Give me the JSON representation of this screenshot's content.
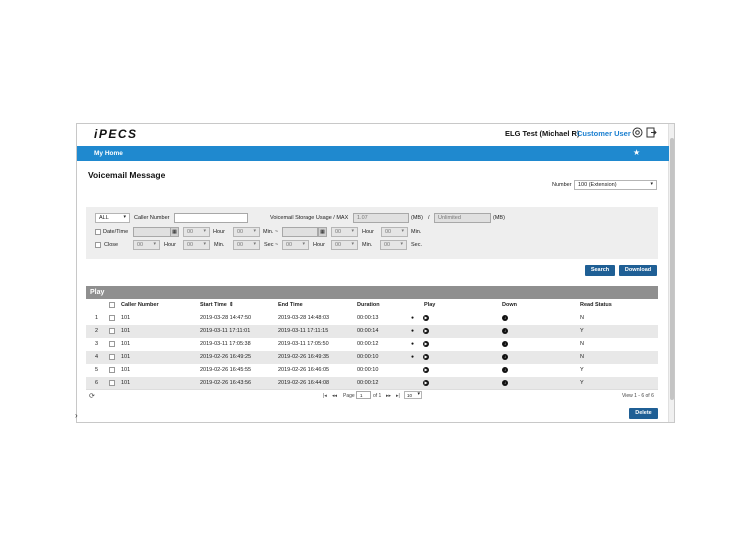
{
  "header": {
    "logo_main": "iPECS",
    "user_name": "ELG Test (Michael R)",
    "user_role": "Customer User",
    "icons": [
      "settings-icon",
      "logout-icon"
    ]
  },
  "nav": {
    "home": "My Home",
    "favorite_icon": "star-icon"
  },
  "page_title": "Voicemail Message",
  "number_filter": {
    "label": "Number",
    "value": "100 (Extension)"
  },
  "filters": {
    "type_value": "ALL",
    "caller_label": "Caller Number",
    "caller_value": "",
    "storage_label": "Voicemail Storage Usage / MAX",
    "storage_used": "1.07",
    "storage_unit_1": "(MB)",
    "slash": "/",
    "storage_max": "Unlimited",
    "storage_unit_2": "(MB)",
    "datetime_label": "Date/Time",
    "close_label": "Close",
    "hour_label": "Hour",
    "min_label": "Min.",
    "sec_label": "Sec.",
    "range_min_label": "Min. ~",
    "range_sec_label": "Sec ~",
    "zero": "00"
  },
  "buttons": {
    "search": "Search",
    "download": "Download",
    "delete": "Delete"
  },
  "grid": {
    "title": "Play",
    "columns": [
      "Caller Number",
      "Start Time",
      "End Time",
      "Duration",
      "Play",
      "Down",
      "Read Status"
    ],
    "sort_icon": "sort-icon",
    "rows": [
      {
        "n": "1",
        "caller": "101",
        "start": "2019-03-28 14:47:50",
        "end": "2019-03-28 14:48:03",
        "dur": "00:00:13",
        "read": "N",
        "drop": true
      },
      {
        "n": "2",
        "caller": "101",
        "start": "2019-03-11 17:11:01",
        "end": "2019-03-11 17:11:15",
        "dur": "00:00:14",
        "read": "Y",
        "drop": true
      },
      {
        "n": "3",
        "caller": "101",
        "start": "2019-03-11 17:05:38",
        "end": "2019-03-11 17:05:50",
        "dur": "00:00:12",
        "read": "N",
        "drop": true
      },
      {
        "n": "4",
        "caller": "101",
        "start": "2019-02-26 16:49:25",
        "end": "2019-02-26 16:49:35",
        "dur": "00:00:10",
        "read": "N",
        "drop": true
      },
      {
        "n": "5",
        "caller": "101",
        "start": "2019-02-26 16:45:55",
        "end": "2019-02-26 16:46:05",
        "dur": "00:00:10",
        "read": "Y",
        "drop": false
      },
      {
        "n": "6",
        "caller": "101",
        "start": "2019-02-26 16:43:56",
        "end": "2019-02-26 16:44:08",
        "dur": "00:00:12",
        "read": "Y",
        "drop": false
      }
    ]
  },
  "pager": {
    "page_label": "Page",
    "page_value": "1",
    "of_label": "of 1",
    "page_size": "10",
    "summary": "View 1 - 6 of 6"
  }
}
